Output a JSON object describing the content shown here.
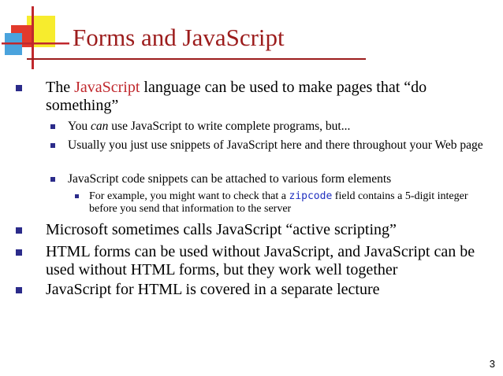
{
  "slide": {
    "title": "Forms and JavaScript",
    "page_number": "3",
    "colors": {
      "title": "#9c1c1c",
      "bullet": "#2b2b8a",
      "highlight": "#c0282d",
      "code": "#2030c0"
    }
  },
  "bullets": [
    {
      "pre": "The ",
      "highlight": "JavaScript",
      "post": " language can be used to make pages that “do something”"
    },
    {
      "pre": "You ",
      "em": "can",
      "post": " use JavaScript to write complete programs, but..."
    },
    {
      "text": "Usually you just use snippets of JavaScript here and there throughout your Web page"
    },
    {
      "text": "JavaScript code snippets can be attached to various form elements"
    },
    {
      "pre": "For example, you might want to check that a ",
      "code": "zipcode",
      "post": " field contains a 5-digit integer before you send that information to the server"
    },
    {
      "text": "Microsoft sometimes calls JavaScript “active scripting”"
    },
    {
      "text": "HTML forms can be used without JavaScript, and JavaScript can be used without HTML forms, but they work well together"
    },
    {
      "text": "JavaScript for HTML is covered in a separate lecture"
    }
  ]
}
